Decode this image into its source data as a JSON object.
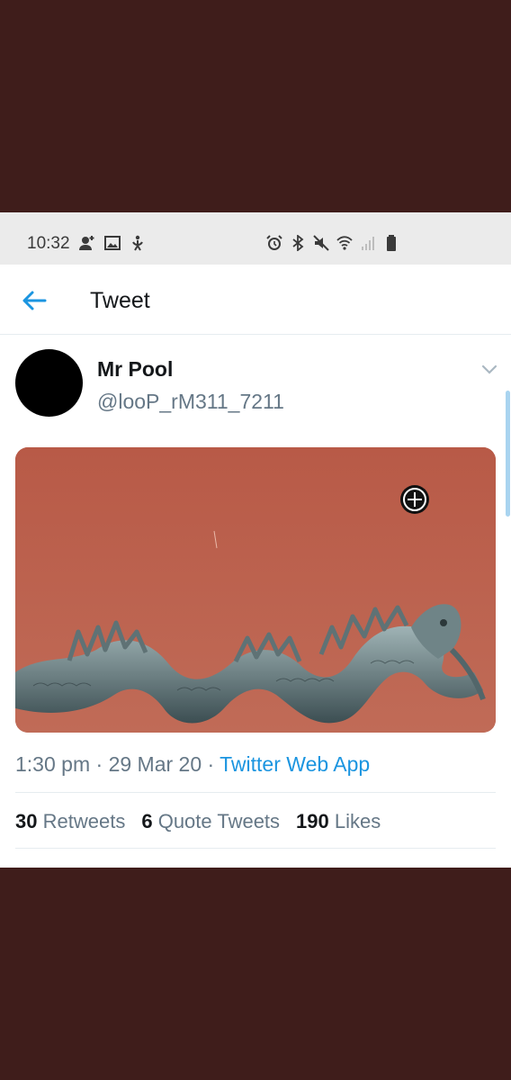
{
  "status_bar": {
    "time": "10:32",
    "icons_left": [
      "person-add-icon",
      "image-icon",
      "accessibility-icon"
    ],
    "icons_right": [
      "alarm-icon",
      "bluetooth-icon",
      "mute-icon",
      "wifi-icon",
      "signal-icon",
      "battery-icon"
    ]
  },
  "header": {
    "title": "Tweet",
    "back_icon": "back-arrow-icon"
  },
  "tweet": {
    "author_name": "Mr Pool",
    "author_handle": "@looP_rM311_7211",
    "time": "1:30 pm",
    "separator": " · ",
    "date": "29 Mar 20",
    "source": "Twitter Web App",
    "media_description_icon": "dragon-image"
  },
  "stats": {
    "retweets_count": "30",
    "retweets_label": "Retweets",
    "quotes_count": "6",
    "quotes_label": "Quote Tweets",
    "likes_count": "190",
    "likes_label": "Likes"
  },
  "colors": {
    "accent": "#1b95e0",
    "background_outer": "#3f1d1b",
    "media_bg": "#b45c4b"
  }
}
